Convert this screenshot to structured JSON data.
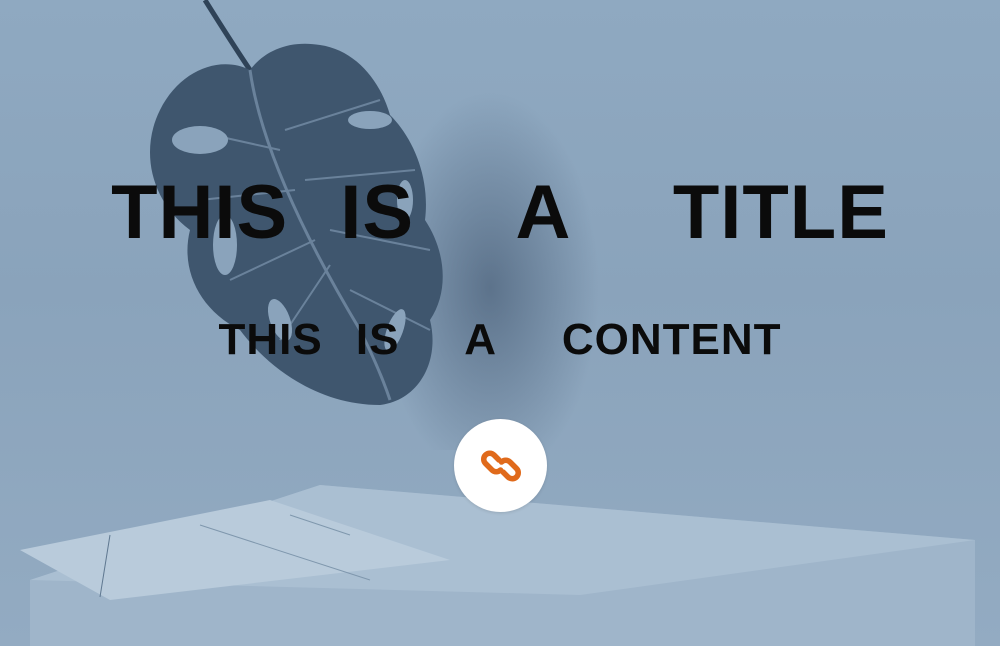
{
  "hero": {
    "title": "THIS IS  A  TITLE",
    "content": "THIS IS  A  CONTENT"
  },
  "link_button": {
    "icon": "link-icon",
    "icon_color": "#e06a1b",
    "background": "#ffffff"
  },
  "colors": {
    "overlay": "#8aa3bb",
    "text": "#0b0b0b"
  }
}
